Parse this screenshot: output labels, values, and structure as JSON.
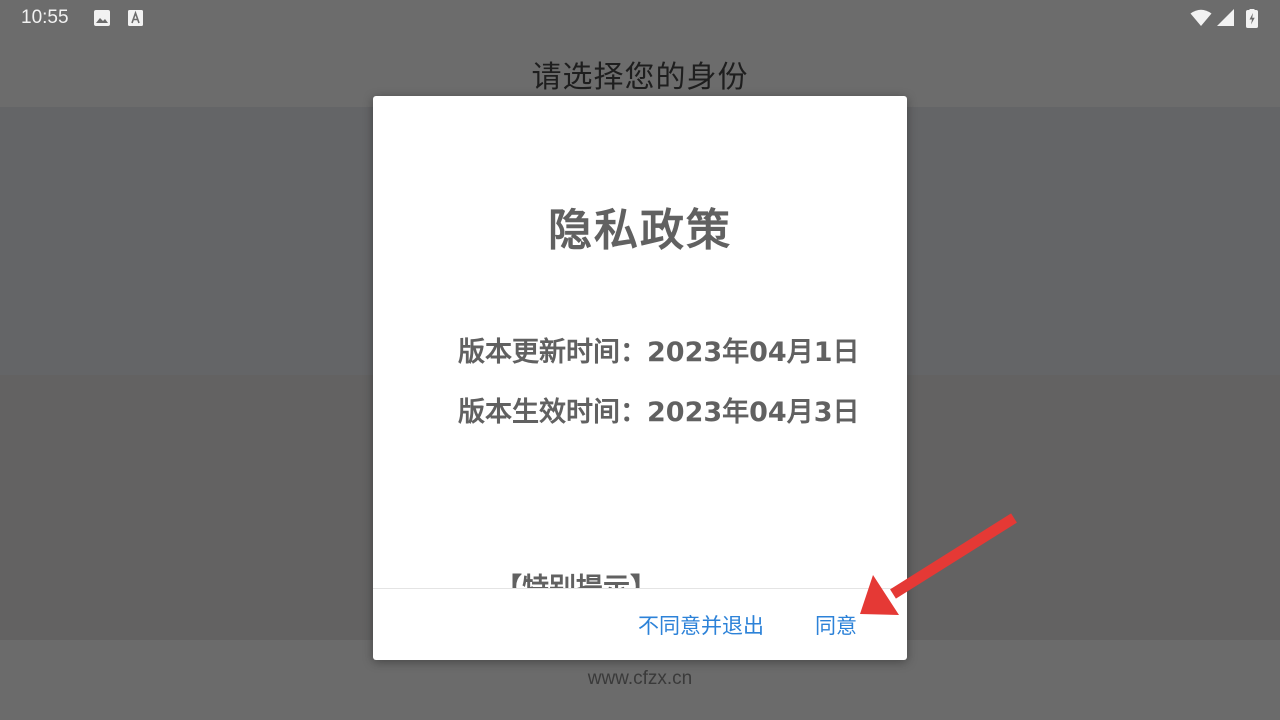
{
  "status_bar": {
    "time": "10:55",
    "left_icons": [
      "image-icon",
      "font-a-icon"
    ],
    "right_icons": [
      "wifi-icon",
      "cellular-signal-icon",
      "battery-charging-icon"
    ]
  },
  "app": {
    "page_title": "请选择您的身份",
    "website": "www.cfzx.cn"
  },
  "dialog": {
    "title": "隐私政策",
    "update_time": "版本更新时间：2023年04月1日",
    "effective_time": "版本生效时间：2023年04月3日",
    "special_notice_heading": "【特别提示】",
    "disagree_button": "不同意并退出",
    "agree_button": "同意",
    "button_color": "#2c82d8"
  },
  "annotation": {
    "arrow_color": "#e53935",
    "arrow_target": "agree_button"
  }
}
